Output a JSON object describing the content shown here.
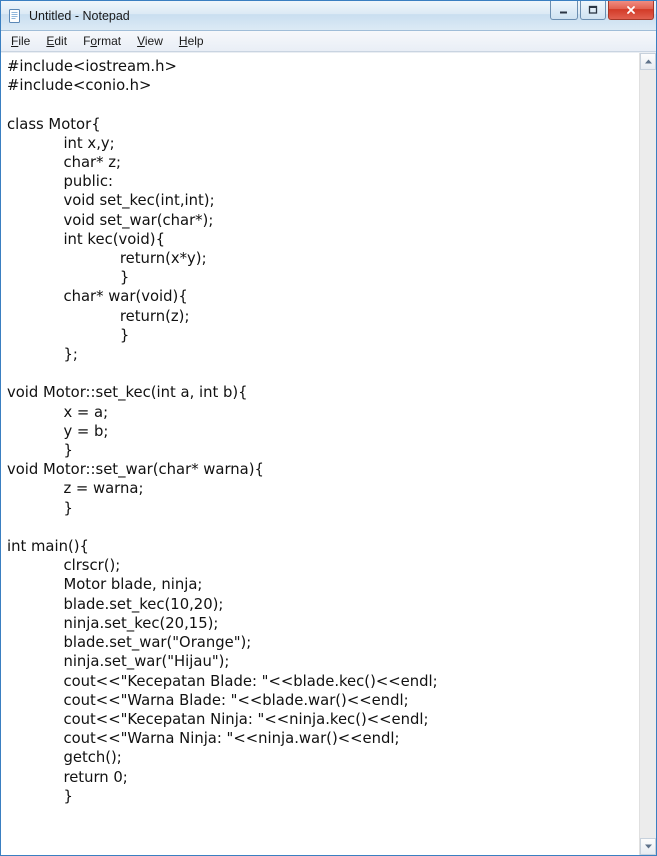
{
  "window": {
    "title": "Untitled - Notepad"
  },
  "menu": {
    "file": "File",
    "edit": "Edit",
    "format": "Format",
    "view": "View",
    "help": "Help"
  },
  "editor": {
    "content": "#include<iostream.h>\n#include<conio.h>\n\nclass Motor{\n            int x,y;\n            char* z;\n            public:\n            void set_kec(int,int);\n            void set_war(char*);\n            int kec(void){\n                        return(x*y);\n                        }\n            char* war(void){\n                        return(z);\n                        }\n            };\n\nvoid Motor::set_kec(int a, int b){\n            x = a;\n            y = b;\n            }\nvoid Motor::set_war(char* warna){\n            z = warna;\n            }\n\nint main(){\n            clrscr();\n            Motor blade, ninja;\n            blade.set_kec(10,20);\n            ninja.set_kec(20,15);\n            blade.set_war(\"Orange\");\n            ninja.set_war(\"Hijau\");\n            cout<<\"Kecepatan Blade: \"<<blade.kec()<<endl;\n            cout<<\"Warna Blade: \"<<blade.war()<<endl;\n            cout<<\"Kecepatan Ninja: \"<<ninja.kec()<<endl;\n            cout<<\"Warna Ninja: \"<<ninja.war()<<endl;\n            getch();\n            return 0;\n            }"
  }
}
